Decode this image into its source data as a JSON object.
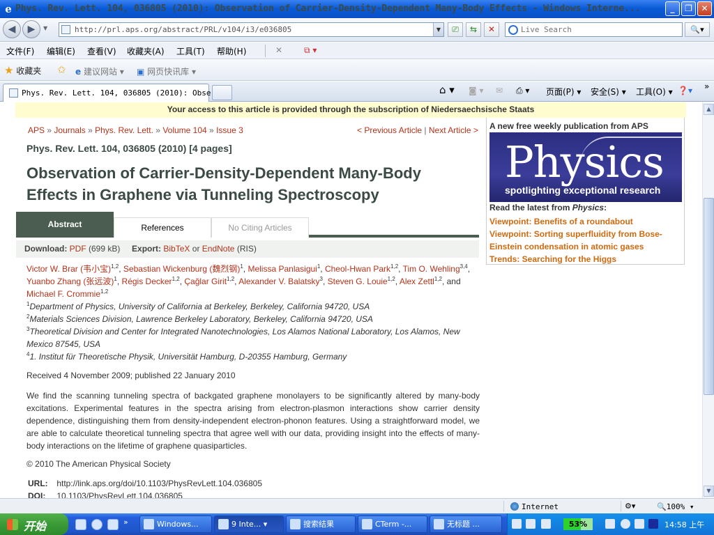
{
  "window": {
    "title": "Phys. Rev. Lett. 104, 036805 (2010): Observation of Carrier-Density-Dependent Many-Body Effects - Windows Interne...",
    "icon": "ie-icon",
    "minimize": "_",
    "restore": "❐",
    "close": "✕"
  },
  "address_bar": {
    "url": "http://prl.aps.org/abstract/PRL/v104/i3/e036805",
    "search_placeholder": "Live Search"
  },
  "menu": [
    "文件(F)",
    "编辑(E)",
    "查看(V)",
    "收藏夹(A)",
    "工具(T)",
    "帮助(H)"
  ],
  "favorites_bar": {
    "favorites": "收藏夹",
    "suggested": "建议网站",
    "webslice": "网页快讯库"
  },
  "tab": {
    "label": "Phys. Rev. Lett. 104, 036805 (2010): Obse..."
  },
  "command_bar": {
    "page": "页面(P)",
    "safety": "安全(S)",
    "tools": "工具(O)"
  },
  "page": {
    "access_notice": "Your access to this article is provided through the subscription of Niedersaechsische Staats",
    "breadcrumb": [
      "APS",
      "Journals",
      "Phys. Rev. Lett.",
      "Volume 104",
      "Issue 3"
    ],
    "breadcrumb_sep": "»",
    "prev_article": "< Previous Article",
    "next_article": "Next Article >",
    "citation": "Phys. Rev. Lett. 104, 036805 (2010) [4 pages]",
    "title": "Observation of Carrier-Density-Dependent Many-Body Effects in Graphene via Tunneling Spectroscopy",
    "tabs": [
      "Abstract",
      "References",
      "No Citing Articles"
    ],
    "download_label": "Download:",
    "download_pdf": "PDF",
    "download_size": "(699 kB)",
    "export_label": "Export:",
    "export_bibtex": "BibTeX",
    "export_or": "or",
    "export_endnote": "EndNote",
    "export_ris": "(RIS)",
    "authors": [
      {
        "name": "Victor W. Brar (韦小宝)",
        "sup": "1,2"
      },
      {
        "name": "Sebastian Wickenburg (魏烈钢)",
        "sup": "1"
      },
      {
        "name": "Melissa Panlasigui",
        "sup": "1"
      },
      {
        "name": "Cheol-Hwan Park",
        "sup": "1,2"
      },
      {
        "name": "Tim O. Wehling",
        "sup": "3,4"
      },
      {
        "name": "Yuanbo Zhang (张远波)",
        "sup": "1"
      },
      {
        "name": "Régis Decker",
        "sup": "1,2"
      },
      {
        "name": "Çağlar Girit",
        "sup": "1,2"
      },
      {
        "name": "Alexander V. Balatsky",
        "sup": "3"
      },
      {
        "name": "Steven G. Louie",
        "sup": "1,2"
      },
      {
        "name": "Alex Zettl",
        "sup": "1,2"
      },
      {
        "name": "Michael F. Crommie",
        "sup": "1,2"
      }
    ],
    "authors_and": "and",
    "affiliations": [
      {
        "num": "1",
        "text": "Department of Physics, University of California at Berkeley, Berkeley, California 94720, USA"
      },
      {
        "num": "2",
        "text": "Materials Sciences Division, Lawrence Berkeley Laboratory, Berkeley, California 94720, USA"
      },
      {
        "num": "3",
        "text": "Theoretical Division and Center for Integrated Nanotechnologies, Los Alamos National Laboratory, Los Alamos, New Mexico 87545, USA"
      },
      {
        "num": "4",
        "text": "1. Institut für Theoretische Physik, Universität Hamburg, D-20355 Hamburg, Germany"
      }
    ],
    "received": "Received 4 November 2009; published 22 January 2010",
    "abstract": "We find the scanning tunneling spectra of backgated graphene monolayers to be significantly altered by many-body excitations. Experimental features in the spectra arising from electron-plasmon interactions show carrier density dependence, distinguishing them from density-independent electron-phonon features. Using a straightforward model, we are able to calculate theoretical tunneling spectra that agree well with our data, providing insight into the effects of many-body interactions on the lifetime of graphene quasiparticles.",
    "copyright": "© 2010 The American Physical Society",
    "url_label": "URL:",
    "url_value": "http://link.aps.org/doi/10.1103/PhysRevLett.104.036805",
    "doi_label": "DOI:",
    "doi_value": "10.1103/PhysRevLett.104.036805"
  },
  "sidebar": {
    "heading": "A new free weekly publication from APS",
    "ad_word": "Physics",
    "ad_tagline": "spotlighting exceptional research",
    "latest_prefix": "Read the latest from ",
    "latest_journal": "Physics",
    "latest_suffix": ":",
    "links": [
      "Viewpoint: Benefits of a roundabout",
      "Viewpoint: Sorting superfluidity from Bose-Einstein condensation in atomic gases",
      "Trends: Searching for the Higgs"
    ]
  },
  "status_bar": {
    "zone": "Internet",
    "zoom": "100%"
  },
  "taskbar": {
    "start": "开始",
    "tasks": [
      "Windows...",
      "9 Inte...",
      "搜索结果",
      "CTerm -...",
      "无标题 ..."
    ],
    "battery": "53%",
    "clock": "14:58 上午"
  },
  "colors": {
    "accent_green": "#4a5d50",
    "link_red": "#b5321a",
    "sidebar_link_orange": "#d06a10",
    "access_banner": "#fffcd0"
  }
}
